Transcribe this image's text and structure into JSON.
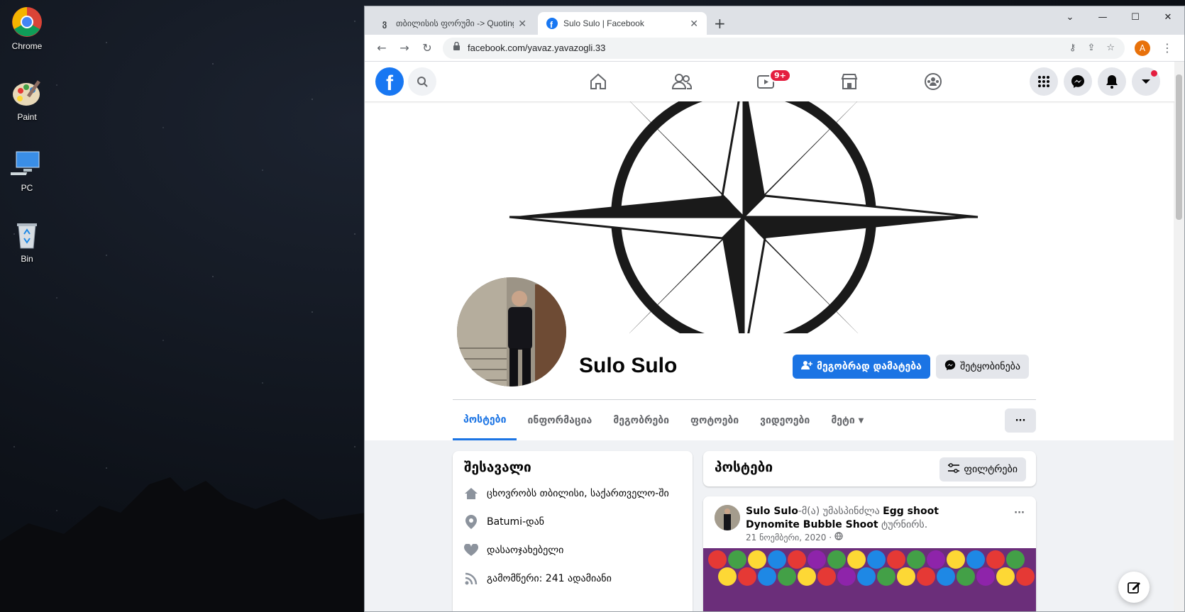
{
  "desktop": {
    "icons": [
      {
        "label": "Chrome",
        "icon": "chrome-icon"
      },
      {
        "label": "Paint",
        "icon": "paint-icon"
      },
      {
        "label": "PC",
        "icon": "computer-icon"
      },
      {
        "label": "Bin",
        "icon": "recycle-bin-icon"
      }
    ]
  },
  "browser": {
    "tabs": [
      {
        "title": "თბილისის ფორუმი -> Quoting",
        "favicon": "forum-icon"
      },
      {
        "title": "Sulo Sulo | Facebook",
        "favicon": "facebook-icon"
      }
    ],
    "url": "facebook.com/yavaz.yavazogli.33",
    "profile_initial": "A"
  },
  "fb_nav": {
    "watch_badge": "9+"
  },
  "profile": {
    "name": "Sulo Sulo",
    "add_friend_label": "მეგობრად დამატება",
    "message_label": "შეტყობინება",
    "tabs": [
      "პოსტები",
      "ინფორმაცია",
      "მეგობრები",
      "ფოტოები",
      "ვიდეოები",
      "მეტი"
    ],
    "more_button": "···"
  },
  "intro": {
    "title": "შესავალი",
    "items": [
      {
        "icon": "home-icon",
        "text": "ცხოვრობს თბილისი, საქართველო-ში"
      },
      {
        "icon": "location-pin-icon",
        "text": "Batumi-დან"
      },
      {
        "icon": "heart-icon",
        "text": "დასაოჯახებელი"
      },
      {
        "icon": "rss-icon",
        "text": "გამომწერი: 241 ადამიანი"
      }
    ]
  },
  "posts": {
    "title": "პოსტები",
    "filter_label": "ფილტრები",
    "post": {
      "author": "Sulo Sulo",
      "action_pre": "-მ(ა) უმასპინძლა ",
      "game": "Egg shoot Dynomite Bubble Shoot",
      "action_post": " ტურნირს.",
      "date": "21 ნოემბერი, 2020 ·",
      "menu": "···"
    }
  },
  "colors": {
    "fb_blue": "#1877f2",
    "badge_red": "#e41e3f",
    "page_bg": "#f0f2f5"
  }
}
